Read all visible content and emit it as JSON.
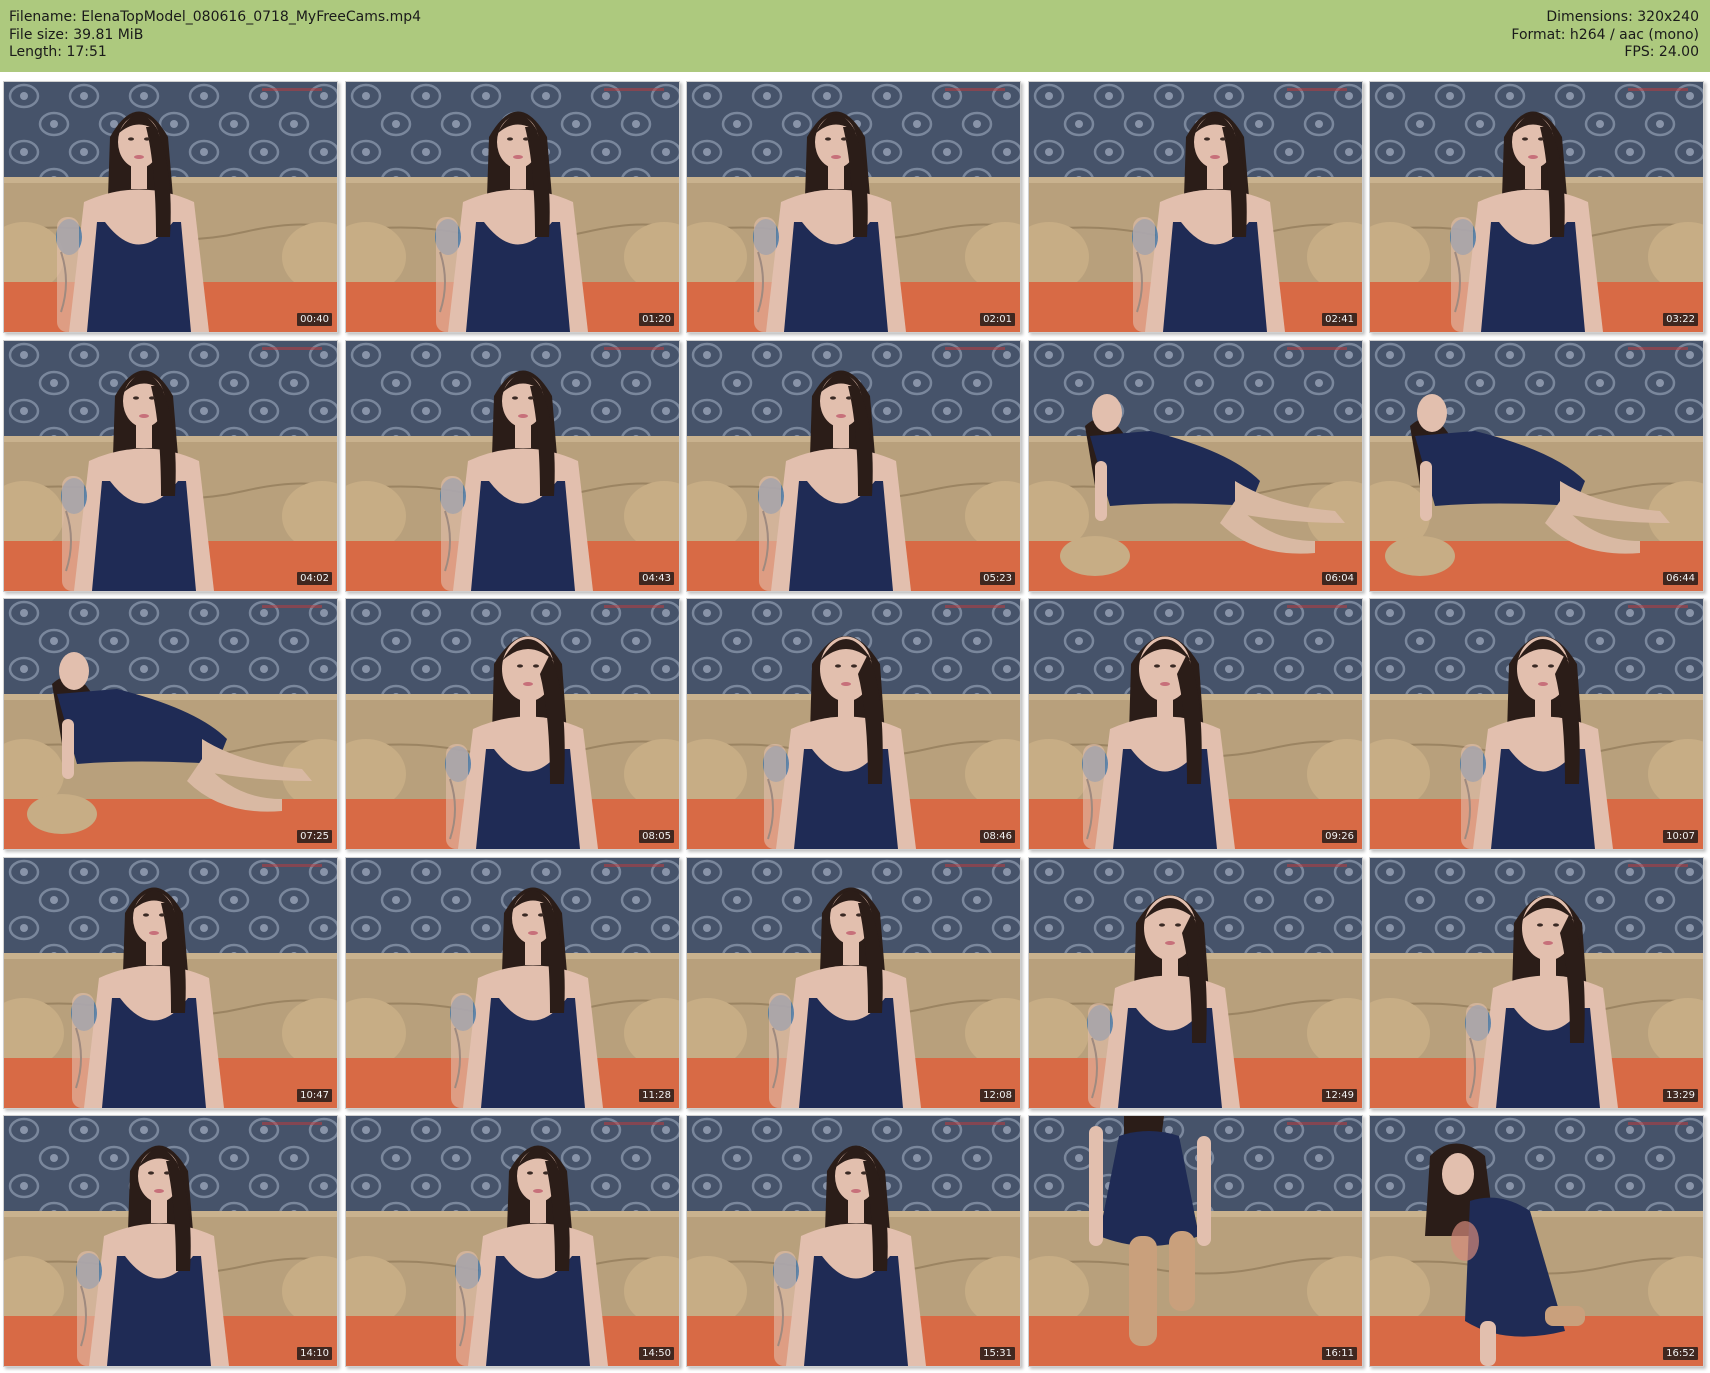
{
  "header": {
    "filename_line": "Filename: ElenaTopModel_080616_0718_MyFreeCams.mp4",
    "filesize_line": "File size: 39.81 MiB",
    "length_line": "Length: 17:51",
    "dimensions_line": "Dimensions: 320x240",
    "format_line": "Format: h264 / aac (mono)",
    "fps_line": "FPS: 24.00"
  },
  "colors": {
    "header_bg": "#adc97e",
    "curtain": "#46536a",
    "sofa": "#b8a07c",
    "cushion": "#d86a45",
    "dress": "#1f2b55",
    "hair": "#2b1d18",
    "skin": "#e2bfae"
  },
  "thumbnails": [
    {
      "timestamp": "00:40",
      "pose": "sit"
    },
    {
      "timestamp": "01:20",
      "pose": "sit"
    },
    {
      "timestamp": "02:01",
      "pose": "sit"
    },
    {
      "timestamp": "02:41",
      "pose": "sit"
    },
    {
      "timestamp": "03:22",
      "pose": "sit"
    },
    {
      "timestamp": "04:02",
      "pose": "sit"
    },
    {
      "timestamp": "04:43",
      "pose": "sit"
    },
    {
      "timestamp": "05:23",
      "pose": "sit"
    },
    {
      "timestamp": "06:04",
      "pose": "lie"
    },
    {
      "timestamp": "06:44",
      "pose": "lie"
    },
    {
      "timestamp": "07:25",
      "pose": "lie"
    },
    {
      "timestamp": "08:05",
      "pose": "close"
    },
    {
      "timestamp": "08:46",
      "pose": "close"
    },
    {
      "timestamp": "09:26",
      "pose": "close"
    },
    {
      "timestamp": "10:07",
      "pose": "close"
    },
    {
      "timestamp": "10:47",
      "pose": "sit"
    },
    {
      "timestamp": "11:28",
      "pose": "sit"
    },
    {
      "timestamp": "12:08",
      "pose": "sit"
    },
    {
      "timestamp": "12:49",
      "pose": "close"
    },
    {
      "timestamp": "13:29",
      "pose": "close"
    },
    {
      "timestamp": "14:10",
      "pose": "sit"
    },
    {
      "timestamp": "14:50",
      "pose": "sit"
    },
    {
      "timestamp": "15:31",
      "pose": "sit"
    },
    {
      "timestamp": "16:11",
      "pose": "stand"
    },
    {
      "timestamp": "16:52",
      "pose": "kneel"
    }
  ]
}
